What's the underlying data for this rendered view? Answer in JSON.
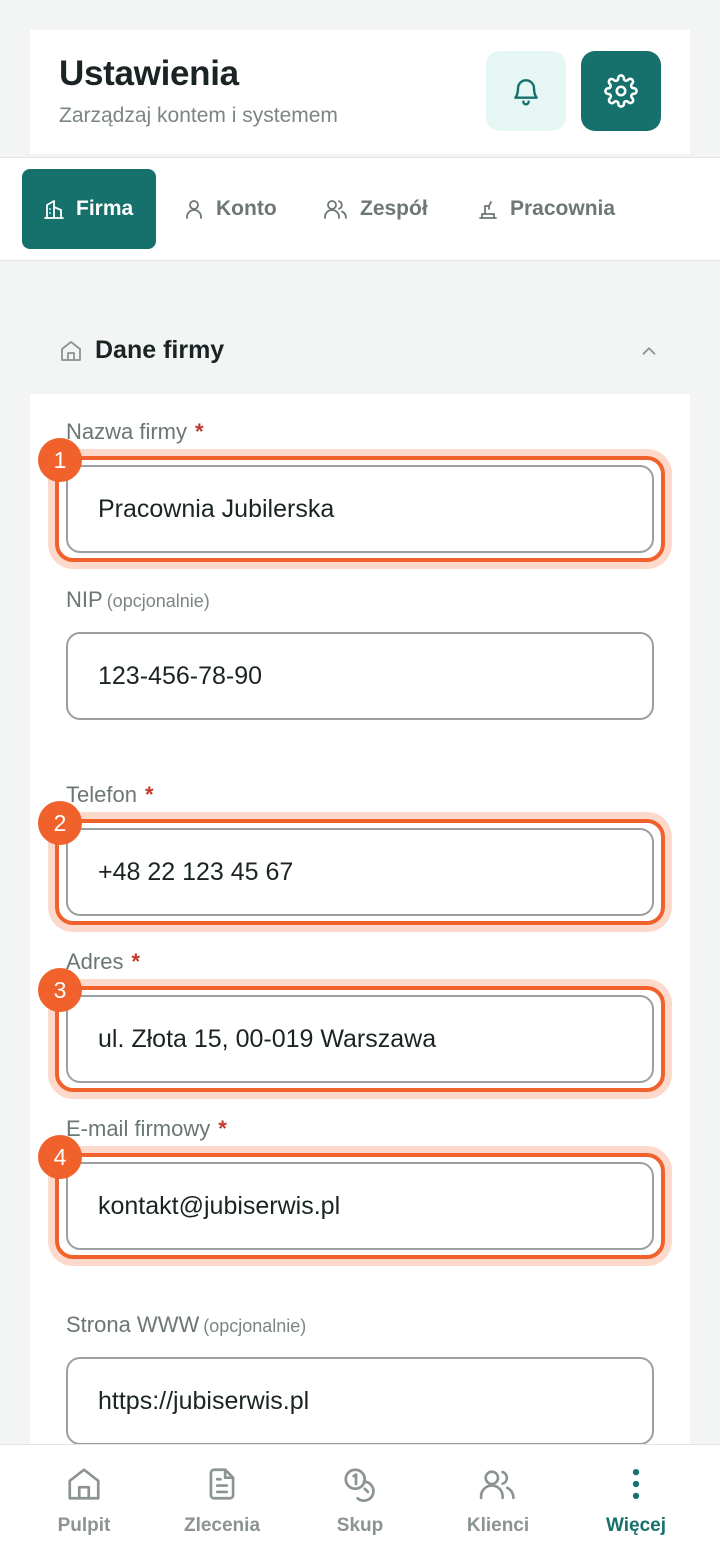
{
  "header": {
    "title": "Ustawienia",
    "subtitle": "Zarządzaj kontem i systemem",
    "bell_icon": "bell-icon",
    "settings_icon": "gear-icon"
  },
  "tabs": [
    {
      "label": "Firma",
      "icon": "building-icon",
      "active": true
    },
    {
      "label": "Konto",
      "icon": "user-icon",
      "active": false
    },
    {
      "label": "Zespół",
      "icon": "users-icon",
      "active": false
    },
    {
      "label": "Pracownia",
      "icon": "workbench-icon",
      "active": false
    }
  ],
  "section": {
    "title": "Dane firmy",
    "icon": "home-icon",
    "collapse_icon": "chevron-up-icon"
  },
  "fields": {
    "company_name": {
      "label": "Nazwa firmy",
      "required_mark": "*",
      "value": "Pracownia Jubilerska",
      "badge": "1"
    },
    "nip": {
      "label": "NIP",
      "optional": "(opcjonalnie)",
      "value": "123-456-78-90"
    },
    "phone": {
      "label": "Telefon",
      "required_mark": "*",
      "value": "+48 22 123 45 67",
      "badge": "2"
    },
    "address": {
      "label": "Adres",
      "required_mark": "*",
      "value": "ul. Złota 15, 00-019 Warszawa",
      "badge": "3"
    },
    "email": {
      "label": "E-mail firmowy",
      "required_mark": "*",
      "value": "kontakt@jubiserwis.pl",
      "badge": "4"
    },
    "website": {
      "label": "Strona WWW",
      "optional": "(opcjonalnie)",
      "value": "https://jubiserwis.pl"
    }
  },
  "bottom_nav": [
    {
      "label": "Pulpit",
      "icon": "home-icon",
      "active": false
    },
    {
      "label": "Zlecenia",
      "icon": "document-icon",
      "active": false
    },
    {
      "label": "Skup",
      "icon": "coins-icon",
      "active": false
    },
    {
      "label": "Klienci",
      "icon": "users-icon",
      "active": false
    },
    {
      "label": "Więcej",
      "icon": "more-vertical-icon",
      "active": true
    }
  ],
  "colors": {
    "primary": "#16716c",
    "primary_light": "#e6f6f4",
    "highlight": "#f0612b",
    "required": "#c0392b"
  }
}
